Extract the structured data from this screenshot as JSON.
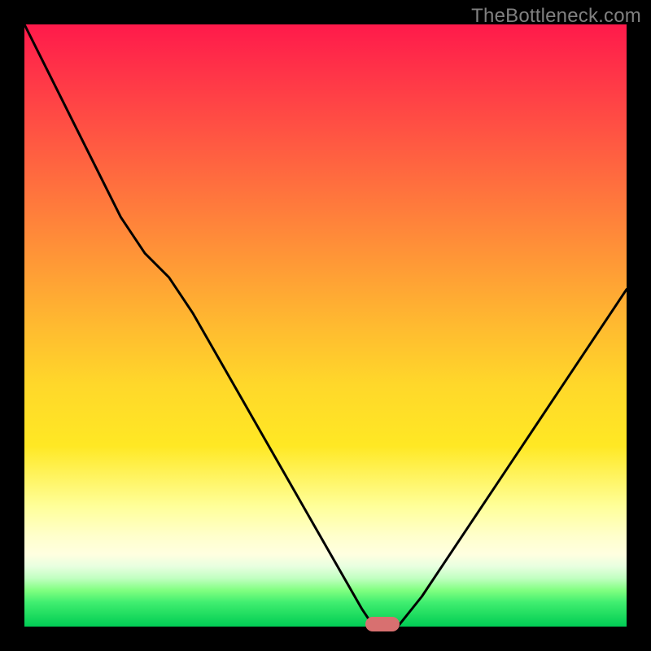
{
  "watermark": "TheBottleneck.com",
  "chart_data": {
    "type": "line",
    "title": "",
    "xlabel": "",
    "ylabel": "",
    "x": [
      0.0,
      0.04,
      0.08,
      0.12,
      0.16,
      0.2,
      0.24,
      0.28,
      0.32,
      0.36,
      0.4,
      0.44,
      0.48,
      0.52,
      0.56,
      0.58,
      0.6,
      0.62,
      0.66,
      0.7,
      0.74,
      0.78,
      0.82,
      0.86,
      0.9,
      0.94,
      0.98,
      1.0
    ],
    "y": [
      1.0,
      0.92,
      0.84,
      0.76,
      0.68,
      0.62,
      0.58,
      0.52,
      0.45,
      0.38,
      0.31,
      0.24,
      0.17,
      0.1,
      0.03,
      0.0,
      0.0,
      0.0,
      0.05,
      0.11,
      0.17,
      0.23,
      0.29,
      0.35,
      0.41,
      0.47,
      0.53,
      0.56
    ],
    "xlim": [
      0,
      1
    ],
    "ylim": [
      0,
      1
    ],
    "marker": {
      "x": 0.595,
      "y": 0.0
    },
    "background_gradient": [
      "#ff1a4b",
      "#ffba30",
      "#ffff99",
      "#00cc55"
    ],
    "frame_color": "#000000"
  }
}
